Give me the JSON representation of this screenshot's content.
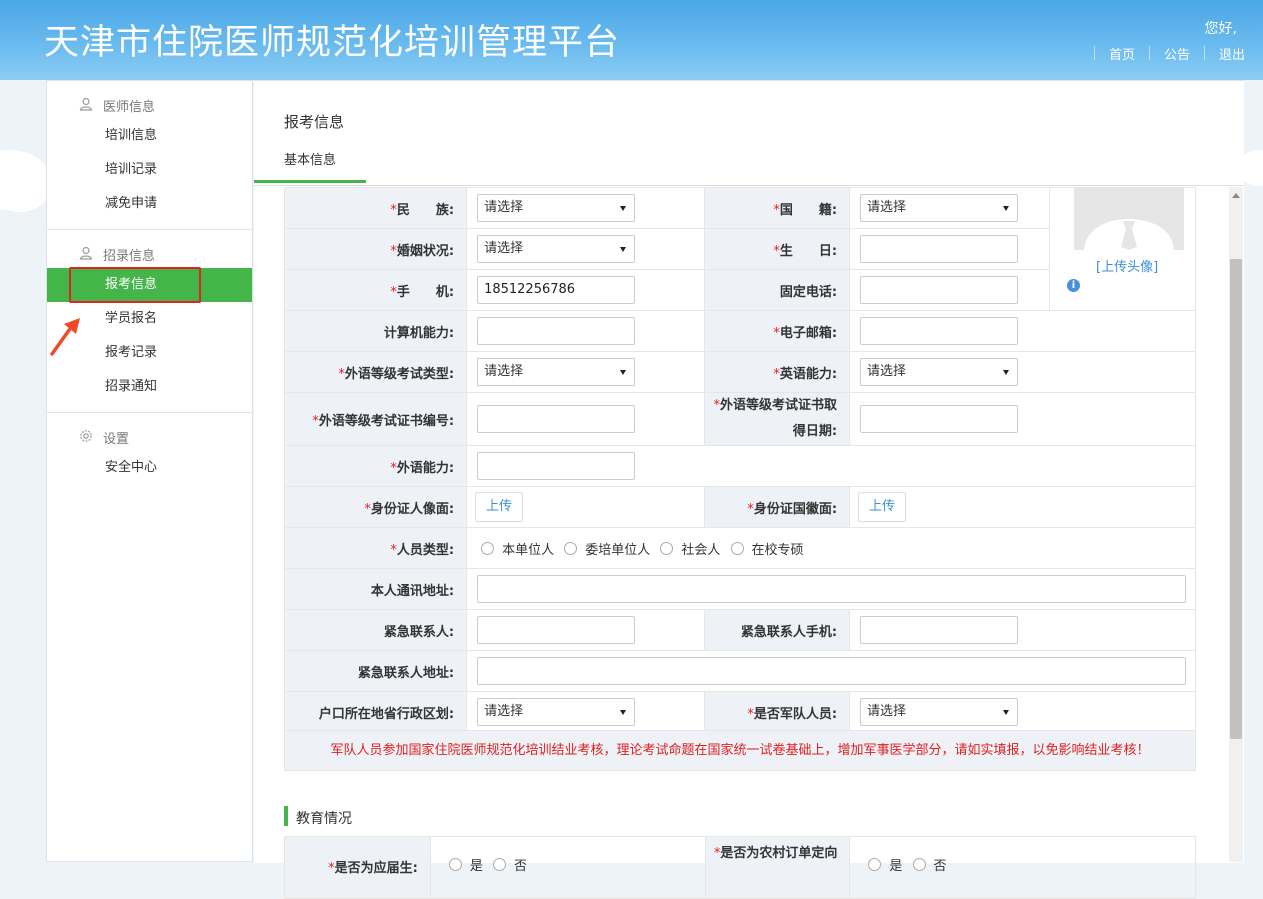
{
  "header": {
    "title": "天津市住院医师规范化培训管理平台",
    "greeting": "您好,",
    "nav": [
      "首页",
      "公告",
      "退出"
    ]
  },
  "sidebar": {
    "group1": "医师信息",
    "group1_items": [
      "培训信息",
      "培训记录",
      "减免申请"
    ],
    "group2": "招录信息",
    "group2_items": [
      "报考信息",
      "学员报名",
      "报考记录",
      "招录通知"
    ],
    "group3": "设置",
    "group3_items": [
      "安全中心"
    ]
  },
  "page": {
    "title": "报考信息",
    "tab": "基本信息"
  },
  "form": {
    "ethnic": "民　　族:",
    "nationality": "国　　籍:",
    "marital": "婚姻状况:",
    "birthday": "生　　日:",
    "mobile": "手　　机:",
    "mobile_value": "18512256786",
    "landline": "固定电话:",
    "computer": "计算机能力:",
    "email": "电子邮箱:",
    "lang_exam_type": "外语等级考试类型:",
    "english": "英语能力:",
    "lang_cert_no": "外语等级考试证书编号:",
    "lang_cert_date": "外语等级考试证书取得日期:",
    "lang_ability": "外语能力:",
    "id_front": "身份证人像面:",
    "id_back": "身份证国徽面:",
    "person_type": "人员类型:",
    "person_types": [
      "本单位人",
      "委培单位人",
      "社会人",
      "在校专硕"
    ],
    "address": "本人通讯地址:",
    "emergency_contact": "紧急联系人:",
    "emergency_phone": "紧急联系人手机:",
    "emergency_address": "紧急联系人地址:",
    "hukou_region": "户口所在地省行政区划:",
    "military": "是否军队人员:",
    "select_placeholder": "请选择",
    "upload": "上传",
    "required_mark": "*"
  },
  "avatar": {
    "upload_link": "[上传头像]"
  },
  "notice": "军队人员参加国家住院医师规范化培训结业考核，理论考试命题在国家统一试卷基础上，增加军事医学部分，请如实填报，以免影响结业考核！",
  "education": {
    "title": "教育情况",
    "row1_left": "是否为应届生:",
    "row1_right": "是否为农村订单定向",
    "yes": "是",
    "no": "否"
  },
  "colors": {
    "accent": "#44b549",
    "header": "#4aa7e6",
    "required": "#e02020",
    "link": "#3a8fd6"
  }
}
